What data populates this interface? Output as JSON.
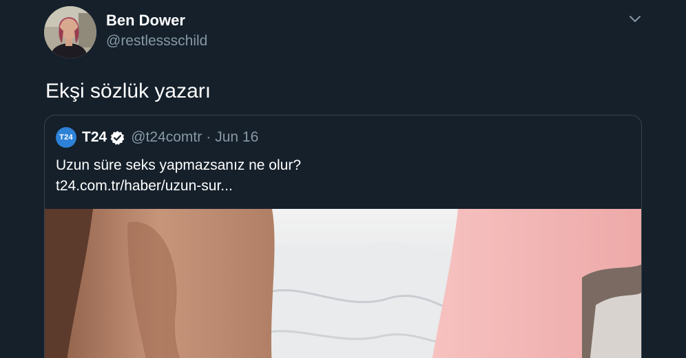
{
  "tweet": {
    "author_name": "Ben Dower",
    "author_handle": "@restlessschild",
    "text": "Ekşi sözlük yazarı",
    "menu_icon": "chevron-down-icon",
    "avatar": "avatar"
  },
  "quote": {
    "avatar_text": "T24",
    "name": "T24",
    "verified_icon": "verified-badge-icon",
    "handle": "@t24comtr",
    "separator": "·",
    "date": "Jun 16",
    "text": "Uzun süre seks yapmazsanız ne olur?",
    "link": "t24.com.tr/haber/uzun-sur..."
  },
  "colors": {
    "background": "#15202b",
    "secondary_text": "#8899a6",
    "border": "#38444d",
    "t24_brand": "#2d82d8"
  }
}
